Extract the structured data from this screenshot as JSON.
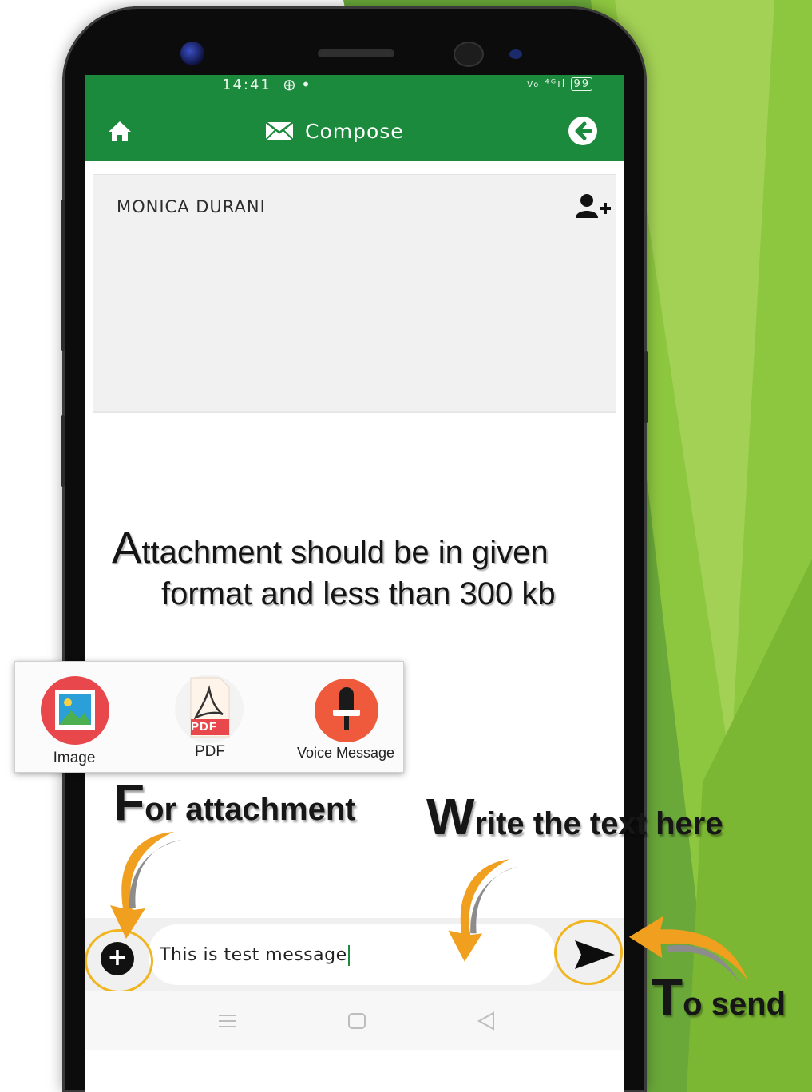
{
  "status_bar": {
    "time": "14:41",
    "battery": "99"
  },
  "app_bar": {
    "title": "Compose"
  },
  "recipient": {
    "name": "MONICA DURANI"
  },
  "info_note": {
    "line1_cap": "A",
    "line1_rest": "ttachment should be in given",
    "line2": "format and less than 300 kb"
  },
  "attachment_options": [
    {
      "label": "Image"
    },
    {
      "label": "PDF",
      "badge": "PDF"
    },
    {
      "label": "Voice Message"
    }
  ],
  "callouts": {
    "attachment": {
      "cap": "F",
      "rest": "or attachment"
    },
    "write": {
      "cap": "W",
      "rest": "rite the text here"
    },
    "send": {
      "cap": "T",
      "rest": "o send"
    }
  },
  "message_input": {
    "value": "This is test message"
  },
  "colors": {
    "app_green": "#1c8a3d",
    "highlight_ring": "#f0b51f",
    "arrow_orange": "#f0a01e",
    "background_green": "#8dc63f"
  }
}
